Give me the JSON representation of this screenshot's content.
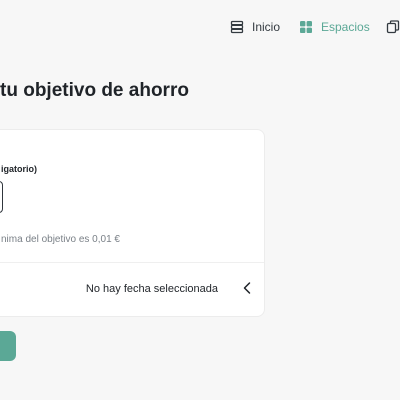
{
  "nav": {
    "home_label": "Inicio",
    "spaces_label": "Espacios"
  },
  "page": {
    "title": "tu objetivo de ahorro"
  },
  "form": {
    "amount_label": "igatorio)",
    "amount_value": "",
    "amount_hint": "nima del objetivo es 0,01 €",
    "date_value": "No hay fecha seleccionada"
  },
  "colors": {
    "accent": "#5ba896",
    "text": "#1f2328",
    "muted": "#7a8087"
  },
  "icons": {
    "home": "list-icon",
    "spaces": "grid-icon",
    "more": "copy-icon",
    "date_toggle": "chevron-left-icon"
  }
}
